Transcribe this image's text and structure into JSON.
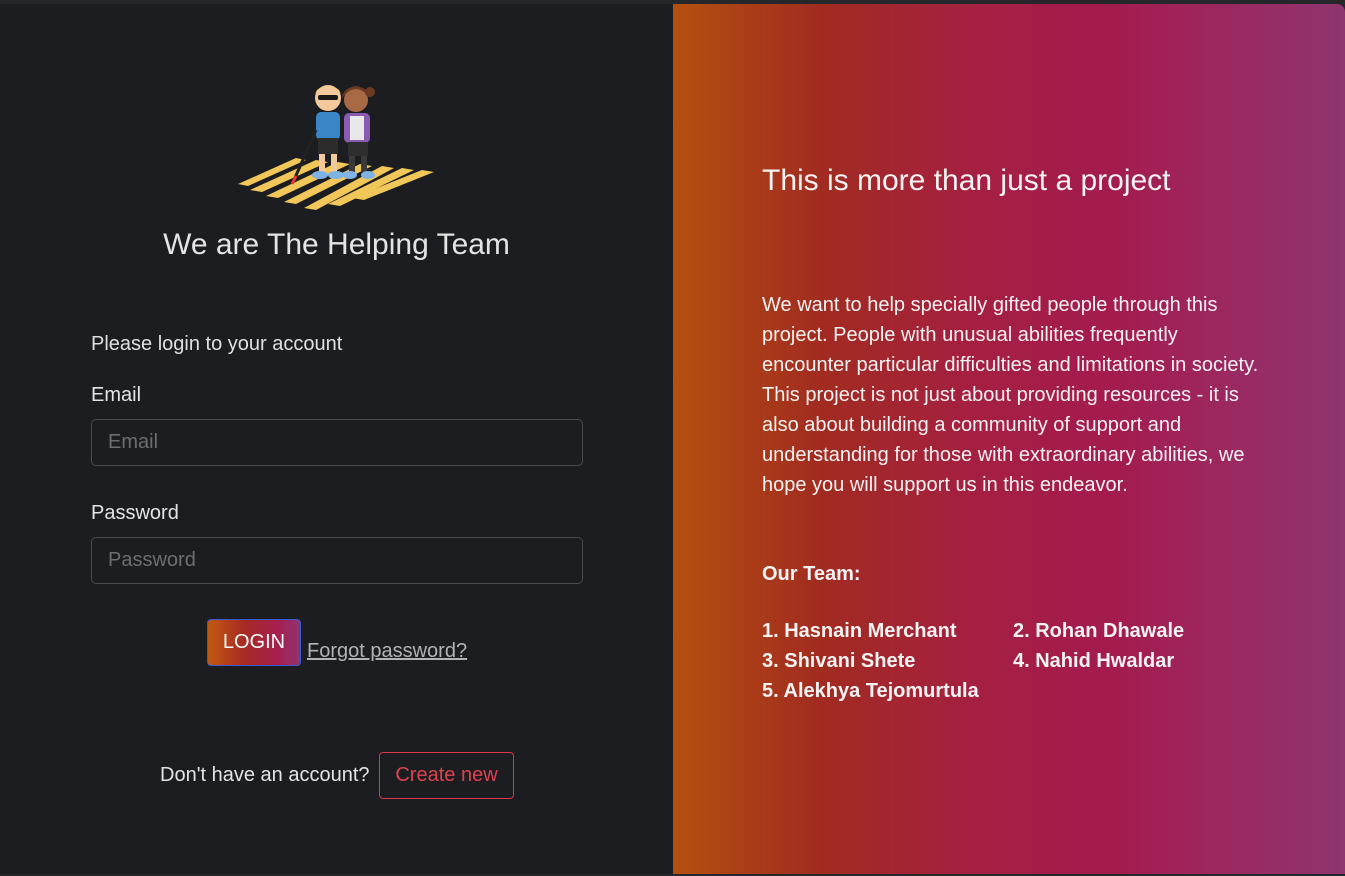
{
  "login": {
    "brand_title": "We are The Helping Team",
    "prompt": "Please login to your account",
    "email_label": "Email",
    "email_placeholder": "Email",
    "email_value": "",
    "password_label": "Password",
    "password_placeholder": "Password",
    "password_value": "",
    "login_button": "LOGIN",
    "forgot_link": "Forgot password?",
    "no_account_text": "Don't have an account?",
    "create_button": "Create new",
    "logo_icon": "blind-person-crosswalk-illustration"
  },
  "about": {
    "title": "This is more than just a project",
    "body": "We want to help specially gifted people through this project. People with unusual abilities frequently encounter particular difficulties and limitations in society. This project is not just about providing resources - it is also about building a community of support and understanding for those with extraordinary abilities, we hope you will support us in this endeavor.",
    "team_heading": "Our Team:",
    "team": [
      "1. Hasnain Merchant",
      "2. Rohan Dhawale",
      "3. Shivani Shete",
      "4. Nahid Hwaldar",
      "5. Alekhya Tejomurtula"
    ]
  },
  "colors": {
    "left_panel_bg": "#1c1d20",
    "gradient_start": "#b5500f",
    "gradient_mid": "#a51f42",
    "gradient_end": "#8e3470",
    "create_button_accent": "#dc3545"
  }
}
